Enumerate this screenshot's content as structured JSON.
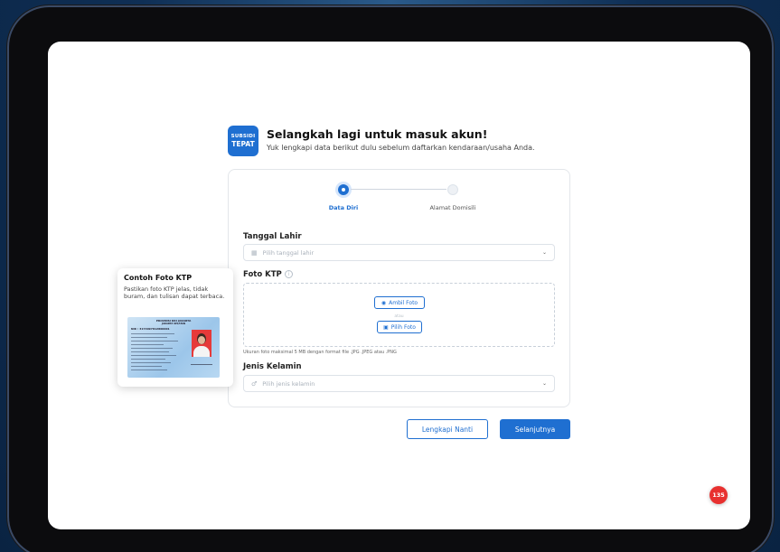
{
  "brand": {
    "logo_line1": "SUBSIDI",
    "logo_line2": "TEPAT",
    "color": "#1f6fd1"
  },
  "header": {
    "title": "Selangkah lagi untuk masuk akun!",
    "subtitle": "Yuk lengkapi data berikut dulu sebelum daftarkan kendaraan/usaha Anda."
  },
  "stepper": {
    "steps": [
      {
        "label": "Data Diri",
        "active": true
      },
      {
        "label": "Alamat Domisili",
        "active": false
      }
    ]
  },
  "form": {
    "birth_date": {
      "label": "Tanggal Lahir",
      "placeholder": "Pilih tanggal lahir",
      "icon": "calendar-icon"
    },
    "ktp_photo": {
      "label": "Foto KTP",
      "take_photo_label": "Ambil Foto",
      "separator": "atau",
      "choose_photo_label": "Pilih Foto",
      "hint": "Ukuran foto maksimal 5 MB dengan format file .JPG .JPEG atau .PNG"
    },
    "gender": {
      "label": "Jenis Kelamin",
      "placeholder": "Pilih jenis kelamin",
      "icon": "gender-icon"
    }
  },
  "actions": {
    "later_label": "Lengkapi Nanti",
    "next_label": "Selanjutnya"
  },
  "ktp_example": {
    "title": "Contoh Foto KTP",
    "description": "Pastikan foto KTP jelas, tidak buram, dan tulisan dapat terbaca.",
    "card_header1": "PROVINSI DKI JAKARTA",
    "card_header2": "JAKARTA SELATAN",
    "card_nik": "NIK   : 3174097812800001"
  },
  "support_badge": {
    "label": "135"
  }
}
